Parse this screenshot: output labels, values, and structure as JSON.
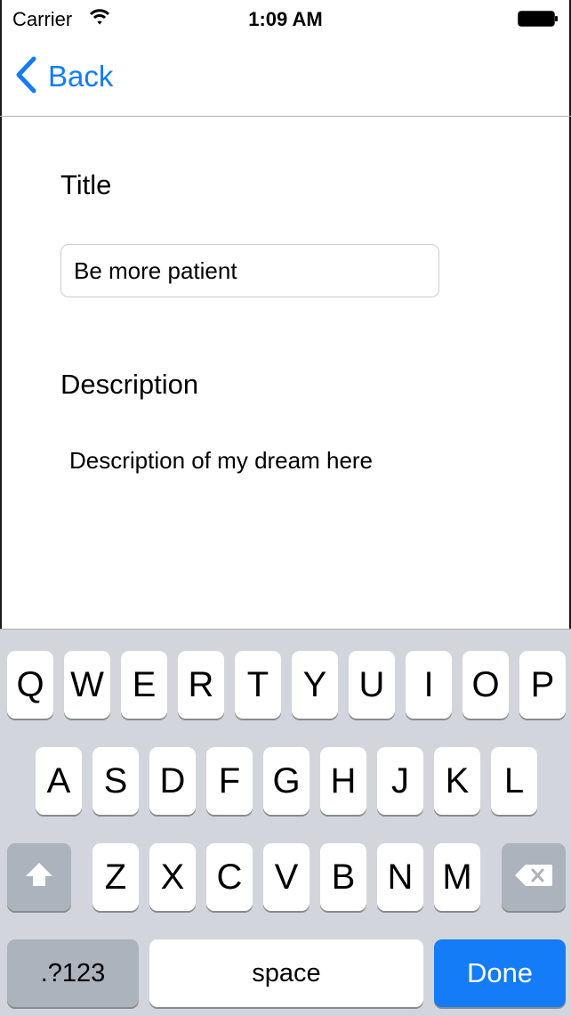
{
  "status_bar": {
    "carrier": "Carrier",
    "time": "1:09 AM"
  },
  "nav": {
    "back_label": "Back"
  },
  "form": {
    "title_label": "Title",
    "title_value": "Be more patient",
    "description_label": "Description",
    "description_value": "Description of my dream here"
  },
  "keyboard": {
    "row1": [
      "Q",
      "W",
      "E",
      "R",
      "T",
      "Y",
      "U",
      "I",
      "O",
      "P"
    ],
    "row2": [
      "A",
      "S",
      "D",
      "F",
      "G",
      "H",
      "J",
      "K",
      "L"
    ],
    "row3": [
      "Z",
      "X",
      "C",
      "V",
      "B",
      "N",
      "M"
    ],
    "numbers_label": ".?123",
    "space_label": "space",
    "done_label": "Done"
  },
  "colors": {
    "accent": "#137cf6",
    "keyboard_bg": "#d2d5db",
    "special_key": "#acb3bd"
  }
}
